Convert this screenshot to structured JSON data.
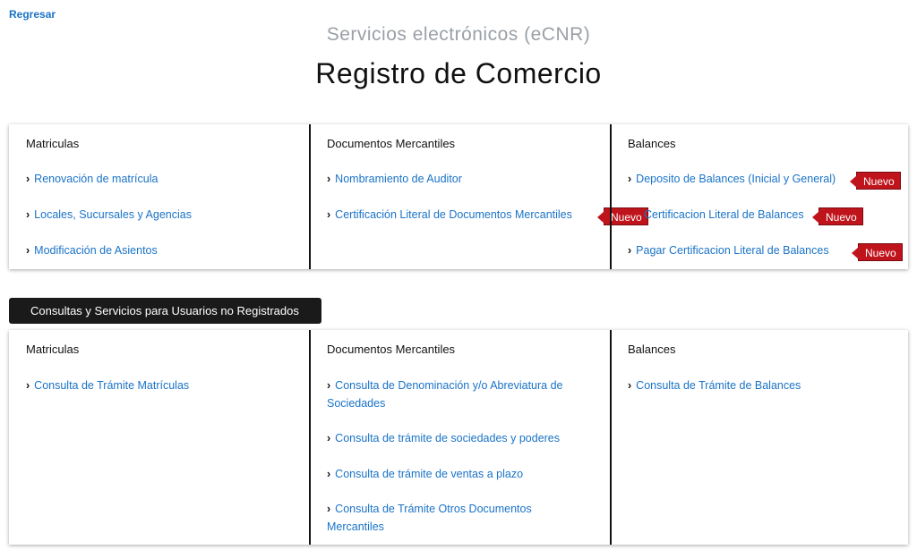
{
  "nav": {
    "back_label": "Regresar"
  },
  "header": {
    "subtitle": "Servicios electrónicos (eCNR)",
    "title": "Registro de Comercio"
  },
  "registered": {
    "columns": [
      {
        "heading": "Matriculas",
        "items": [
          "Renovación de matrícula",
          "Locales, Sucursales y Agencias",
          "Modificación de Asientos"
        ]
      },
      {
        "heading": "Documentos Mercantiles",
        "items": [
          "Nombramiento de Auditor",
          "Certificación Literal de Documentos Mercantiles"
        ]
      },
      {
        "heading": "Balances",
        "items": [
          "Deposito de Balances (Inicial y General)",
          "Certificacion Literal de Balances",
          "Pagar Certificacion Literal de Balances"
        ]
      }
    ],
    "new_badge": "Nuevo"
  },
  "unregistered": {
    "section_label": "Consultas y Servicios para Usuarios no Registrados",
    "columns": [
      {
        "heading": "Matriculas",
        "items": [
          "Consulta de Trámite Matrículas"
        ]
      },
      {
        "heading": "Documentos Mercantiles",
        "items": [
          "Consulta de Denominación y/o Abreviatura de Sociedades",
          "Consulta de trámite de sociedades y poderes",
          "Consulta de trámite de ventas a plazo",
          "Consulta de Trámite Otros Documentos Mercantiles"
        ]
      },
      {
        "heading": "Balances",
        "items": [
          "Consulta de Trámite de Balances"
        ]
      }
    ]
  },
  "icons": {
    "bullet": "chevron-right-icon"
  },
  "colors": {
    "link": "#1a73c7",
    "badge": "#c0141c",
    "dark": "#1a1a1a"
  }
}
